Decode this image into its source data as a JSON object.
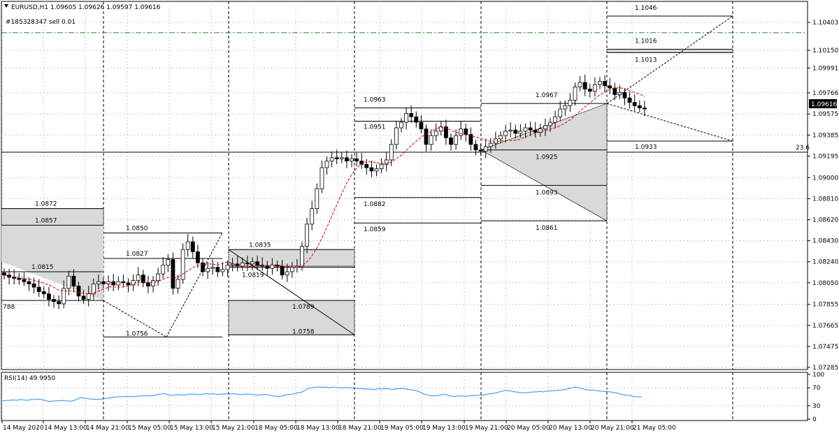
{
  "header": {
    "symbol_line": "EURUSD,H1  1.09605 1.09626 1.09597 1.09616",
    "order_label": "#185328347 sell 0.01"
  },
  "rsi": {
    "label": "RSI(14) 49.9950",
    "levels": [
      "100",
      "70",
      "30",
      "0"
    ]
  },
  "chart_data": {
    "type": "candlestick",
    "symbol": "EURUSD",
    "timeframe": "H1",
    "ohlc": {
      "open": 1.09605,
      "high": 1.09626,
      "low": 1.09597,
      "close": 1.09616
    },
    "current_price": "1.09616",
    "y_ticks": [
      "1.10403",
      "1.10150",
      "1.09991",
      "1.09766",
      "1.09575",
      "1.09385",
      "1.09195",
      "1.09000",
      "1.08810",
      "1.08620",
      "1.08430",
      "1.08240",
      "1.08050",
      "1.07855",
      "1.07665",
      "1.07475",
      "1.07285"
    ],
    "x_ticks": [
      "14 May 2020",
      "14 May 13:00",
      "14 May 21:00",
      "15 May 05:00",
      "15 May 13:00",
      "15 May 21:00",
      "18 May 05:00",
      "18 May 13:00",
      "18 May 21:00",
      "19 May 05:00",
      "19 May 13:00",
      "19 May 21:00",
      "20 May 05:00",
      "20 May 13:00",
      "20 May 21:00",
      "21 May 05:00"
    ],
    "level_labels": [
      "1.1046",
      "1.1016",
      "1.1013",
      "1.0967",
      "1.0963",
      "1.0951",
      "1.0933",
      "1.0925",
      "1.0893",
      "1.0882",
      "1.0861",
      "1.0859",
      "1.0872",
      "1.0857",
      "1.0850",
      "1.0827",
      "1.0835",
      "1.0815",
      "1.0819",
      "1.0789",
      "1.0758",
      "1.0756",
      "788",
      "23.6"
    ],
    "sell_order_price": 1.1031,
    "close_series": [
      1.0812,
      1.081,
      1.0809,
      1.0808,
      1.0806,
      1.0804,
      1.0801,
      1.0797,
      1.0795,
      1.079,
      1.0788,
      1.0786,
      1.08,
      1.0811,
      1.0802,
      1.0793,
      1.079,
      1.0795,
      1.0804,
      1.0806,
      1.0804,
      1.0806,
      1.0803,
      1.0806,
      1.0805,
      1.0803,
      1.0807,
      1.0812,
      1.0805,
      1.0802,
      1.0807,
      1.0813,
      1.0821,
      1.0826,
      1.08,
      1.0808,
      1.0835,
      1.0842,
      1.0833,
      1.0823,
      1.0815,
      1.0818,
      1.0819,
      1.0815,
      1.0817,
      1.0821,
      1.0822,
      1.082,
      1.0823,
      1.0822,
      1.0824,
      1.0821,
      1.082,
      1.0818,
      1.0821,
      1.082,
      1.0812,
      1.0815,
      1.0819,
      1.082,
      1.0838,
      1.0858,
      1.0872,
      1.089,
      1.0909,
      1.0915,
      1.0918,
      1.0917,
      1.0918,
      1.0915,
      1.0917,
      1.0915,
      1.0912,
      1.0909,
      1.0906,
      1.0908,
      1.0912,
      1.0916,
      1.093,
      1.0945,
      1.095,
      1.0958,
      1.0955,
      1.095,
      1.0944,
      1.093,
      1.0938,
      1.0942,
      1.0946,
      1.0936,
      1.093,
      1.0938,
      1.0944,
      1.0939,
      1.093,
      1.0925,
      1.0924,
      1.0928,
      1.0931,
      1.0935,
      1.0938,
      1.0942,
      1.0943,
      1.094,
      1.0942,
      1.0945,
      1.0943,
      1.0941,
      1.0944,
      1.0947,
      1.095,
      1.0955,
      1.0962,
      1.0965,
      1.097,
      1.0982,
      1.0986,
      1.098,
      1.0978,
      1.0984,
      1.0987,
      1.0983,
      1.0981,
      1.0975,
      1.0977,
      1.0972,
      1.0968,
      1.0965,
      1.0963,
      1.0962
    ],
    "rsi_series": [
      41,
      42,
      42,
      43,
      42,
      44,
      43,
      42,
      44,
      44,
      45,
      44,
      42,
      40,
      40,
      41,
      41,
      42,
      41,
      40,
      41,
      44,
      48,
      47,
      46,
      45,
      45,
      44,
      45,
      46,
      47,
      48,
      50,
      50,
      50,
      51,
      51,
      50,
      51,
      52,
      52,
      53,
      52,
      52,
      55,
      56,
      57,
      55,
      53,
      54,
      55,
      54,
      54,
      56,
      56,
      55,
      55,
      56,
      57,
      56,
      57,
      55,
      56,
      56,
      57,
      56,
      57,
      55,
      55,
      56,
      56,
      55,
      54,
      54,
      55,
      55,
      54,
      52,
      51,
      51,
      53,
      55,
      55,
      57,
      59,
      60,
      64,
      69,
      70,
      71,
      72,
      71,
      72,
      70,
      72,
      71,
      70,
      70,
      71,
      70,
      69,
      69,
      68,
      68,
      67,
      67,
      66,
      69,
      67,
      68,
      68,
      66,
      68,
      68,
      69,
      67,
      66,
      65,
      63,
      60,
      56,
      54,
      52,
      52,
      53,
      55,
      55,
      53,
      51,
      51,
      52,
      52,
      51,
      52,
      53,
      53,
      54,
      54,
      56,
      57,
      58,
      60,
      62,
      64,
      64,
      62,
      61,
      60,
      59,
      59,
      60,
      61,
      61,
      62,
      61,
      63,
      63,
      64,
      64,
      65,
      66,
      68,
      70,
      72,
      70,
      68,
      66,
      65,
      65,
      64,
      63,
      62,
      62,
      61,
      60,
      58,
      56,
      54,
      54,
      52,
      50,
      50,
      50
    ]
  }
}
